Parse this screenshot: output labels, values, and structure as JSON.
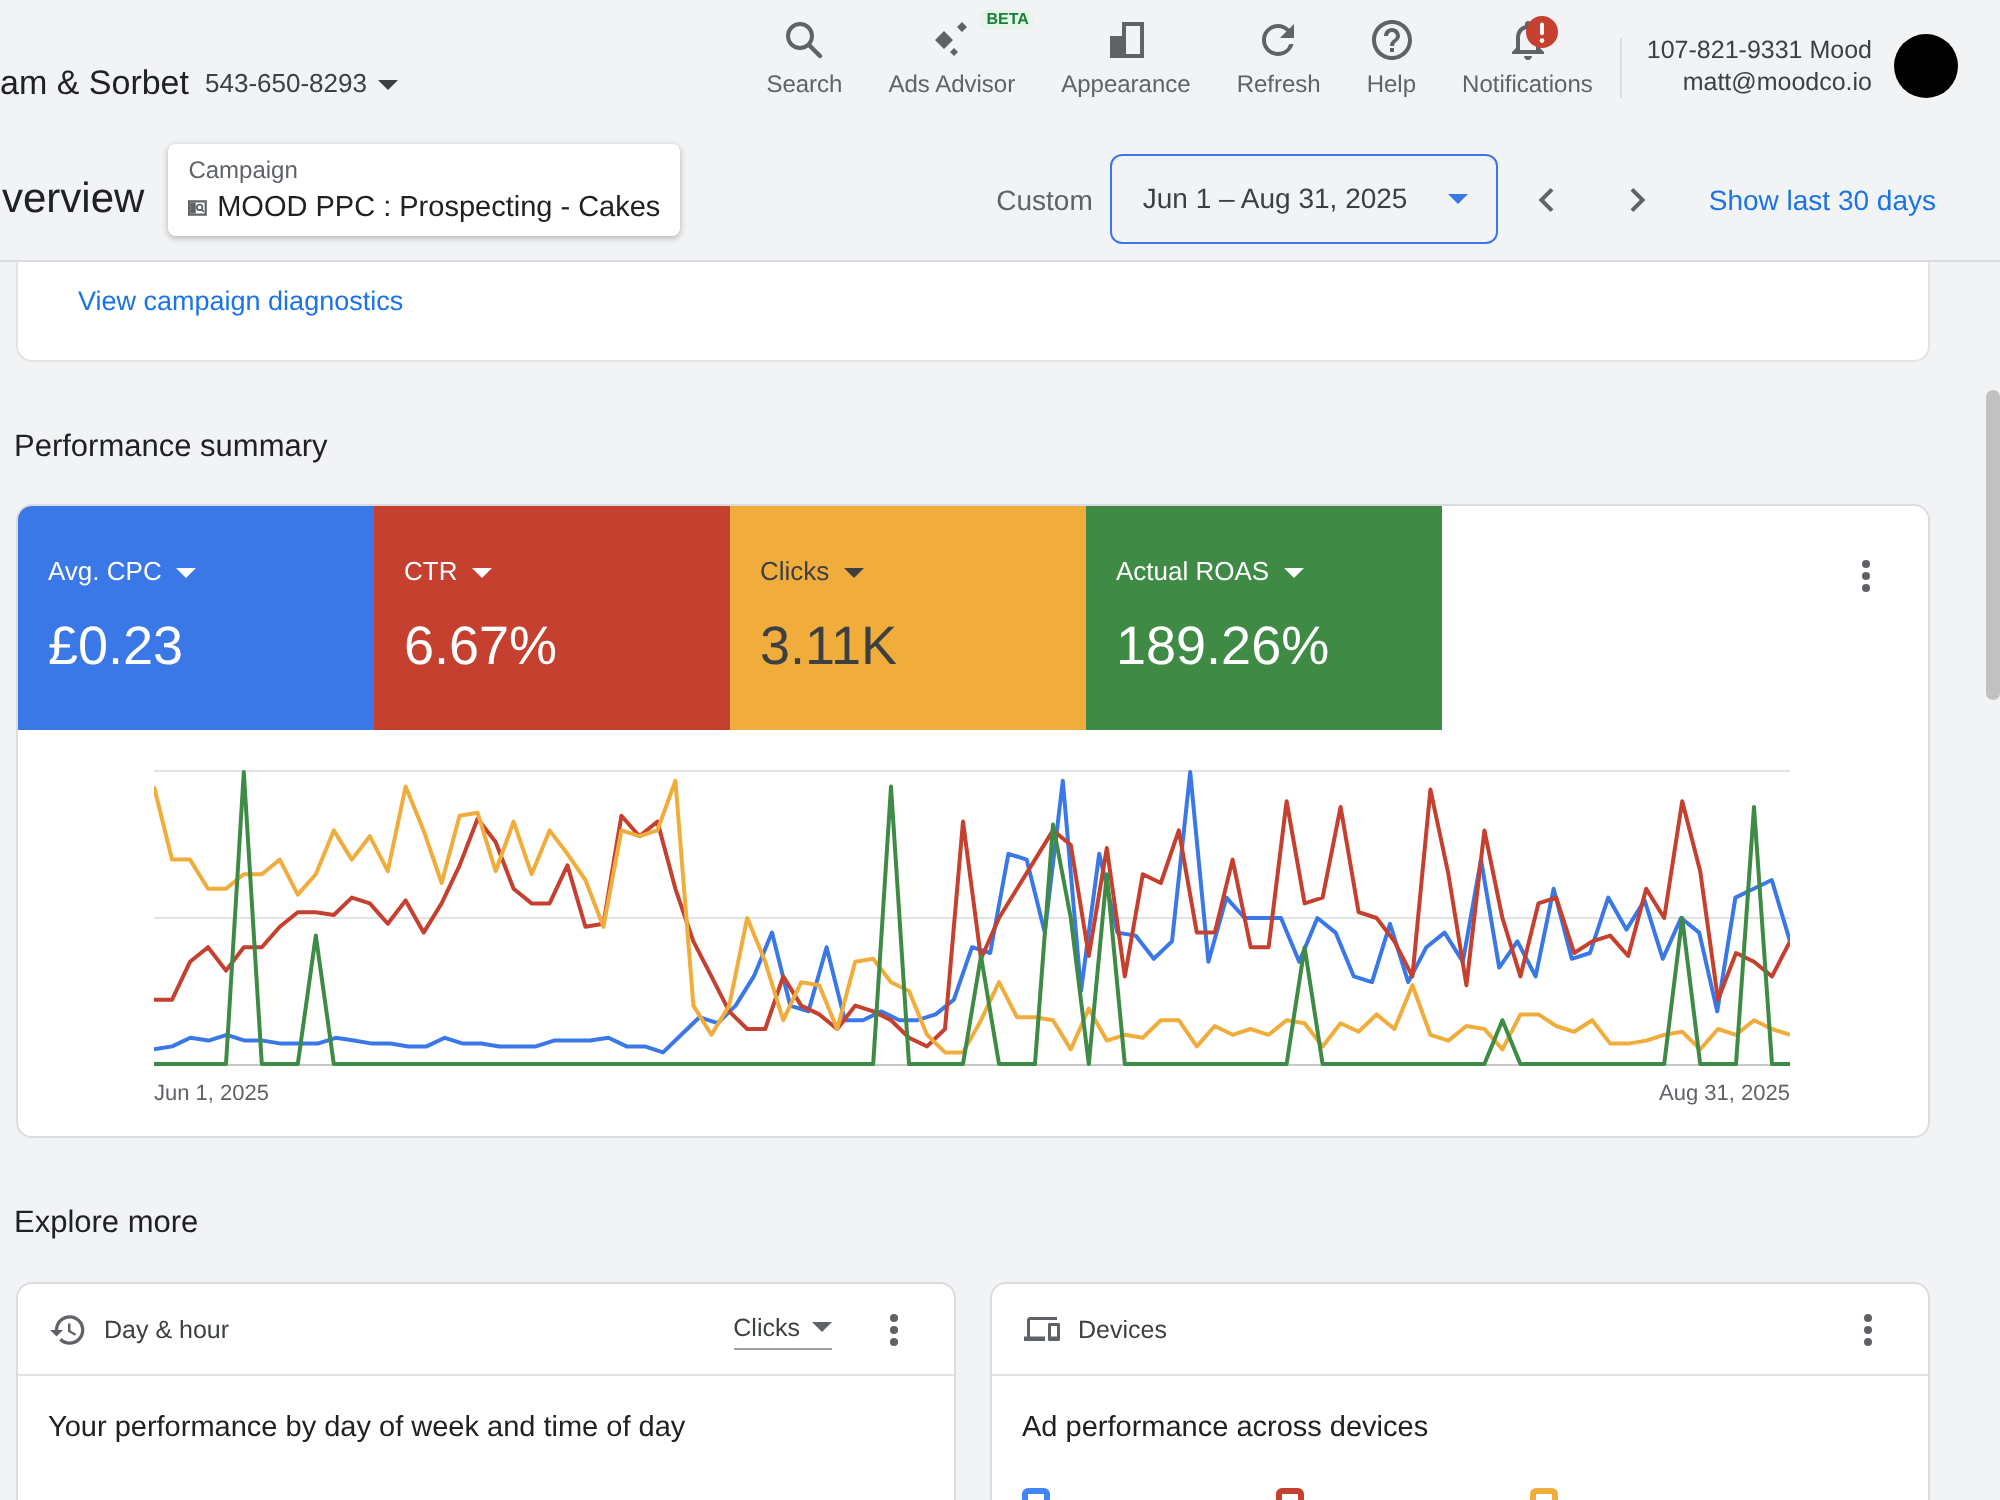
{
  "header": {
    "account_name": "am & Sorbet",
    "account_id": "543-650-8293",
    "nav": [
      {
        "kind": "search",
        "label": "Search"
      },
      {
        "kind": "advisor",
        "label": "Ads Advisor",
        "badge": "BETA"
      },
      {
        "kind": "appearance",
        "label": "Appearance"
      },
      {
        "kind": "refresh",
        "label": "Refresh"
      },
      {
        "kind": "help",
        "label": "Help"
      },
      {
        "kind": "notifications",
        "label": "Notifications",
        "alert": true
      }
    ],
    "user": {
      "account": "107-821-9331 Mood",
      "email": "matt@moodco.io"
    }
  },
  "toolbar": {
    "page_title": "verview",
    "campaign": {
      "label": "Campaign",
      "value": "MOOD PPC : Prospecting - Cakes"
    },
    "date_range": {
      "preset": "Custom",
      "value": "Jun 1 – Aug 31, 2025"
    },
    "show_last": "Show last 30 days"
  },
  "diagnostics_link": "View campaign diagnostics",
  "performance": {
    "title": "Performance summary",
    "metrics": [
      {
        "label": "Avg. CPC",
        "value": "£0.23",
        "color": "#3b78e7"
      },
      {
        "label": "CTR",
        "value": "6.67%",
        "color": "#c5402f"
      },
      {
        "label": "Clicks",
        "value": "3.11K",
        "color": "#f0ad3c"
      },
      {
        "label": "Actual ROAS",
        "value": "189.26%",
        "color": "#3f8b46"
      }
    ],
    "chart": {
      "x_labels": [
        "Jun 1, 2025",
        "Aug 31, 2025"
      ]
    }
  },
  "explore": {
    "title": "Explore more",
    "cards": [
      {
        "kind": "day_hour",
        "title": "Day & hour",
        "metric": "Clicks",
        "body": "Your performance by day of week and time of day"
      },
      {
        "kind": "devices",
        "title": "Devices",
        "body": "Ad performance across devices",
        "legend": [
          {
            "color": "#4285f4"
          },
          {
            "color": "#c5402f"
          },
          {
            "color": "#f0ad3c"
          }
        ]
      }
    ]
  }
}
